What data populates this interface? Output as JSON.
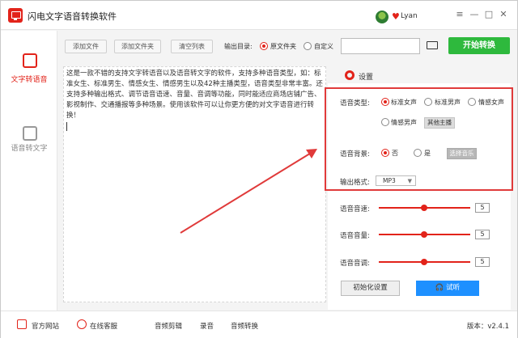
{
  "app": {
    "title": "闪电文字语音转换软件",
    "username": "Lyan",
    "win_controls": [
      "≡",
      "—",
      "□",
      "✕"
    ]
  },
  "sidebar": {
    "items": [
      {
        "label": "文字转语音"
      },
      {
        "label": "语音转文字"
      }
    ]
  },
  "toolbar": {
    "add_file": "添加文件",
    "add_folder": "添加文件夹",
    "clear": "清空列表",
    "output_label": "输出目录:",
    "opt_source": "原文件夹",
    "opt_custom": "自定义",
    "path_value": "",
    "start": "开始转换"
  },
  "editor": {
    "text": "这是一款不错的支持文字转语音以及语音转文字的软件，支持多种语音类型，如：标准女生、标准男生、情感女生、情感男生以及42种主播类型，语音类型非常丰富。还支持多种输出格式、调节语音语速、音量、音调等功能，同时能适应商场店铺广告、影视制作、交通播报等多种场景。使用该软件可以让你更方便的对文字语音进行转换！"
  },
  "settings": {
    "title": "设置",
    "voice_type_label": "语音类型:",
    "voice_options": [
      "标准女声",
      "标准男声",
      "情感女声",
      "情感男声"
    ],
    "selected_voice": "标准女声",
    "other_host": "其他主播",
    "bg_label": "语音背景:",
    "bg_no": "否",
    "bg_yes": "是",
    "choose_music": "选择音乐",
    "format_label": "输出格式:",
    "format_value": "MP3",
    "speed_label": "语音音速:",
    "speed_value": "5",
    "volume_label": "语音音量:",
    "volume_value": "5",
    "pitch_label": "语音音调:",
    "pitch_value": "5",
    "init": "初始化设置",
    "listen": "试听"
  },
  "statusbar": {
    "website": "官方网站",
    "support": "在线客服",
    "audio_cut": "音频剪辑",
    "record": "录音",
    "audio_convert": "音频转换",
    "version": "版本：v2.4.1"
  },
  "colors": {
    "accent": "#e2231a",
    "start": "#2eb93d",
    "listen": "#1e90ff",
    "highlight": "#e03a3a"
  }
}
